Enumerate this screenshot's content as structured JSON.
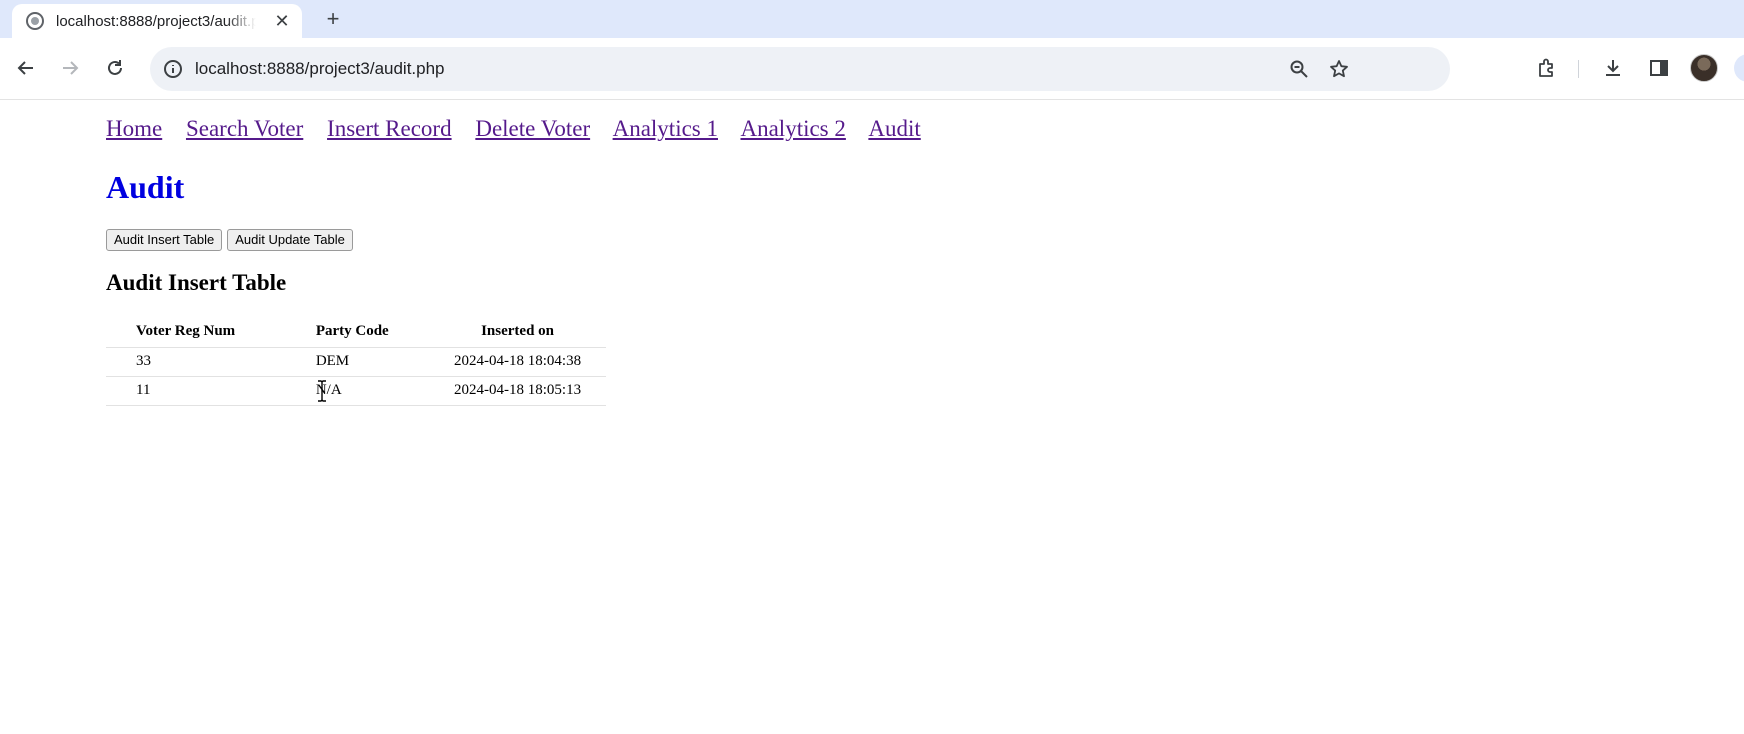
{
  "browser": {
    "tab": {
      "title": "localhost:8888/project3/audit.php"
    },
    "address_bar": {
      "url": "localhost:8888/project3/audit.php"
    }
  },
  "nav": {
    "links": [
      "Home",
      "Search Voter",
      "Insert Record",
      "Delete Voter",
      "Analytics 1",
      "Analytics 2",
      "Audit"
    ]
  },
  "page": {
    "title": "Audit",
    "buttons": {
      "insert": "Audit Insert Table",
      "update": "Audit Update Table"
    },
    "section_title": "Audit Insert Table",
    "table": {
      "headers": [
        "Voter Reg Num",
        "Party Code",
        "Inserted on"
      ],
      "rows": [
        [
          "33",
          "DEM",
          "2024-04-18 18:04:38"
        ],
        [
          "11",
          "N/A",
          "2024-04-18 18:05:13"
        ]
      ]
    }
  },
  "colors": {
    "title": "#0000e0",
    "link": "#551a8b",
    "tabstrip": "#dfe8fb"
  }
}
